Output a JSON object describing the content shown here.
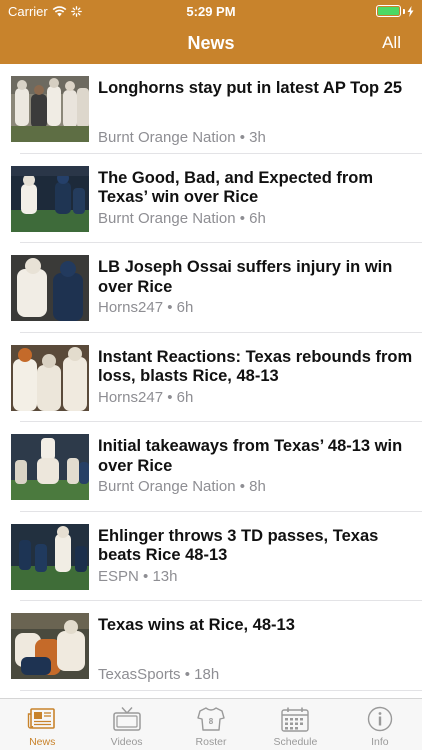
{
  "status": {
    "carrier": "Carrier",
    "time": "5:29 PM"
  },
  "navbar": {
    "title": "News",
    "right_button": "All"
  },
  "articles": [
    {
      "title": "Longhorns stay put in latest AP Top 25",
      "source": "Burnt Orange Nation",
      "age": "3h"
    },
    {
      "title": "The Good, Bad, and Expected from Texas’ win over Rice",
      "source": "Burnt Orange Nation",
      "age": "6h"
    },
    {
      "title": "LB Joseph Ossai suffers injury in win over Rice",
      "source": "Horns247",
      "age": "6h"
    },
    {
      "title": "Instant Reactions: Texas rebounds from loss, blasts Rice, 48-13",
      "source": "Horns247",
      "age": "6h"
    },
    {
      "title": "Initial takeaways from Texas’ 48-13 win over Rice",
      "source": "Burnt Orange Nation",
      "age": "8h"
    },
    {
      "title": "Ehlinger throws 3 TD passes, Texas beats Rice 48-13",
      "source": "ESPN",
      "age": "13h"
    },
    {
      "title": "Texas wins at Rice, 48-13",
      "source": "TexasSports",
      "age": "18h"
    }
  ],
  "tabbar": {
    "news": "News",
    "videos": "Videos",
    "roster": "Roster",
    "schedule": "Schedule",
    "info": "Info"
  },
  "colors": {
    "accent": "#c8832c",
    "inactive": "#9a9a9a",
    "battery": "#4cd964"
  }
}
